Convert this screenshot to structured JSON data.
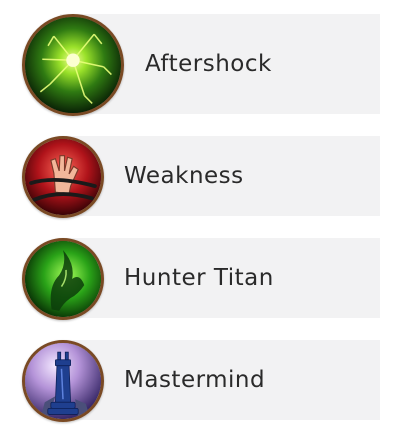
{
  "rows": [
    {
      "label": "Aftershock",
      "icon": "aftershock-icon"
    },
    {
      "label": "Weakness",
      "icon": "weakness-icon"
    },
    {
      "label": "Hunter Titan",
      "icon": "hunter-titan-icon"
    },
    {
      "label": "Mastermind",
      "icon": "mastermind-icon"
    }
  ],
  "colors": {
    "row_background": "#f2f2f3",
    "icon_border": "#7a4a24",
    "label_text": "#2a2a2a"
  }
}
